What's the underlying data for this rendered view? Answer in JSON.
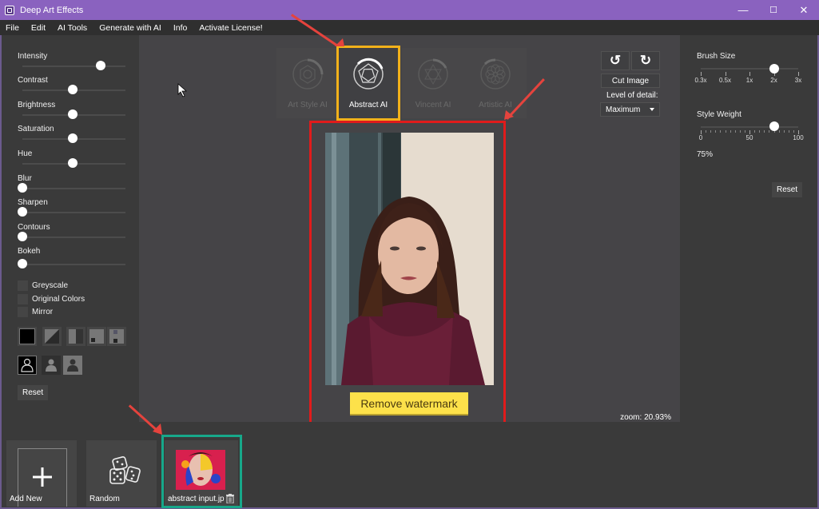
{
  "window": {
    "title": "Deep Art Effects",
    "controls": {
      "minimize": "—",
      "maximize": "☐",
      "close": "✕"
    }
  },
  "menu": [
    "File",
    "Edit",
    "AI Tools",
    "Generate with AI",
    "Info",
    "Activate License!"
  ],
  "left_panel": {
    "sliders": [
      {
        "label": "Intensity",
        "value": 0.78
      },
      {
        "label": "Contrast",
        "value": 0.5
      },
      {
        "label": "Brightness",
        "value": 0.5
      },
      {
        "label": "Saturation",
        "value": 0.5
      },
      {
        "label": "Hue",
        "value": 0.5
      },
      {
        "label": "Blur",
        "value": 0.0
      },
      {
        "label": "Sharpen",
        "value": 0.0
      },
      {
        "label": "Contours",
        "value": 0.0
      },
      {
        "label": "Bokeh",
        "value": 0.0
      }
    ],
    "checkboxes": [
      {
        "label": "Greyscale",
        "checked": false
      },
      {
        "label": "Original Colors",
        "checked": false
      },
      {
        "label": "Mirror",
        "checked": false
      }
    ],
    "blend_modes": [
      "full-fill",
      "diagonal-split",
      "vertical-split",
      "corner-small",
      "two-corners"
    ],
    "person_modes": [
      "person-outline",
      "person-foreground",
      "person-background"
    ],
    "reset_label": "Reset"
  },
  "style_tiles": [
    {
      "label": "Art Style AI",
      "icon": "hexagon-icon",
      "active": false
    },
    {
      "label": "Abstract AI",
      "icon": "pentagon-icon",
      "active": true
    },
    {
      "label": "Vincent AI",
      "icon": "geometric-flower-icon",
      "active": false
    },
    {
      "label": "Artistic AI",
      "icon": "mandala-icon",
      "active": false
    }
  ],
  "tools": {
    "undo_icon": "↺",
    "redo_icon": "↻",
    "cut_label": "Cut Image",
    "level_label": "Level of detail:",
    "level_value": "Maximum"
  },
  "canvas": {
    "watermark_label": "Remove watermark",
    "zoom_text": "zoom: 20.93%"
  },
  "right_panel": {
    "brush_label": "Brush Size",
    "brush_ticks": [
      "0.3x",
      "0.5x",
      "1x",
      "2x",
      "3x"
    ],
    "brush_value_index": 3,
    "style_weight_label": "Style Weight",
    "style_weight_ticks": [
      "0",
      "50",
      "100"
    ],
    "style_weight_value": 75,
    "style_weight_text": "75%",
    "reset_label": "Reset"
  },
  "bottom": {
    "items": [
      {
        "label": "Add New",
        "icon": "plus-icon"
      },
      {
        "label": "Random",
        "icon": "dice-icon"
      },
      {
        "label": "abstract input.jp",
        "icon": "trash-icon"
      }
    ]
  },
  "annotation_colors": {
    "arrow": "#e5433d",
    "active_style": "#f2b11a",
    "canvas_highlight": "#e01b1b",
    "style_thumb_highlight": "#17a88a"
  }
}
